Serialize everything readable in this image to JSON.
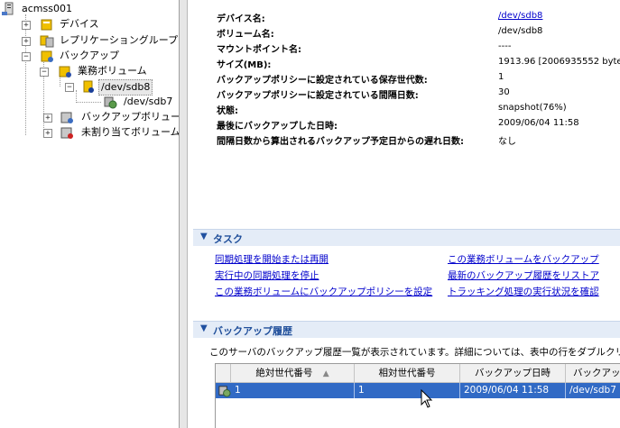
{
  "tree": {
    "server": "acmss001",
    "devices": "デバイス",
    "replication_groups": "レプリケーショングループ",
    "backup": "バックアップ",
    "business_volumes": "業務ボリューム",
    "sdb8": "/dev/sdb8",
    "sdb7": "/dev/sdb7",
    "backup_volumes": "バックアップボリューム",
    "unassigned_volumes": "未割り当てボリューム"
  },
  "properties": {
    "device_name_label": "デバイス名:",
    "device_name_value": "/dev/sdb8",
    "volume_name_label": "ボリューム名:",
    "volume_name_value": "/dev/sdb8",
    "mount_point_label": "マウントポイント名:",
    "mount_point_value": "----",
    "size_label": "サイズ(MB):",
    "size_value": "1913.96 [2006935552 byte",
    "gen_label": "バックアップポリシーに設定されている保存世代数:",
    "gen_value": "1",
    "interval_label": "バックアップポリシーに設定されている間隔日数:",
    "interval_value": "30",
    "status_label": "状態:",
    "status_value": "snapshot(76%)",
    "last_backup_label": "最後にバックアップした日時:",
    "last_backup_value": "2009/06/04 11:58",
    "delay_label": "間隔日数から算出されるバックアップ予定日からの遅れ日数:",
    "delay_value": "なし"
  },
  "tasks": {
    "header": "タスク",
    "start_sync": "同期処理を開始または再開",
    "stop_sync": "実行中の同期処理を停止",
    "set_policy": "この業務ボリュームにバックアップポリシーを設定",
    "backup_this": "この業務ボリュームをバックアップ",
    "list_history": "最新のバックアップ履歴をリストア",
    "tracking": "トラッキング処理の実行状況を確認"
  },
  "history": {
    "header": "バックアップ履歴",
    "description": "このサーバのバックアップ履歴一覧が表示されています。詳細については、表中の行をダブルクリック",
    "columns": [
      "絶対世代番号",
      "相対世代番号",
      "バックアップ日時",
      "バックアッ"
    ],
    "rows": [
      [
        "1",
        "1",
        "2009/06/04 11:58",
        "/dev/sdb7"
      ]
    ]
  },
  "colors": {
    "selection": "#316ac5",
    "link": "#0000cc",
    "section_title": "#1f4e9a"
  }
}
